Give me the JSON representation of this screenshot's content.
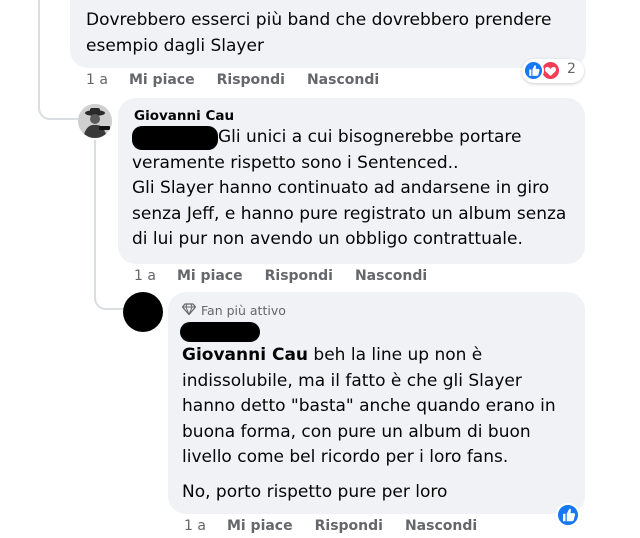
{
  "comment1": {
    "text_line1": "Dovrebbero esserci più band che dovrebbero prendere",
    "text_line2": "esempio dagli Slayer",
    "time": "1 a",
    "like": "Mi piace",
    "reply": "Rispondi",
    "hide": "Nascondi",
    "reaction_count": "2",
    "reaction_icons": [
      "like-icon",
      "love-icon"
    ]
  },
  "comment2": {
    "author": "Giovanni Cau",
    "line1": "Gli unici a cui bisognerebbe portare",
    "line2": "veramente rispetto sono i Sentenced..",
    "line3": "Gli Slayer hanno continuato ad andarsene in giro",
    "line4": "senza Jeff, e hanno pure registrato un album senza",
    "line5": "di lui pur non avendo un obbligo contrattuale.",
    "time": "1 a",
    "like": "Mi piace",
    "reply": "Rispondi",
    "hide": "Nascondi"
  },
  "comment3": {
    "badge": "Fan più attivo",
    "badge_icon": "diamond-icon",
    "mention": "Giovanni Cau",
    "line1_rest": " beh la line up non è",
    "line2": "indissolubile, ma il fatto è che gli Slayer",
    "line3": "hanno detto \"basta\" anche quando erano in",
    "line4": "buona forma, con pure un album di buon",
    "line5": "livello come bel ricordo per i loro fans.",
    "line6": "No, porto rispetto pure per loro",
    "time": "1 a",
    "like": "Mi piace",
    "reply": "Rispondi",
    "hide": "Nascondi",
    "reaction_icon": "like-icon"
  },
  "colors": {
    "bubble": "#f0f2f5",
    "meta": "#65676b",
    "like_blue": "#1877f2",
    "love_red": "#f33e58"
  }
}
